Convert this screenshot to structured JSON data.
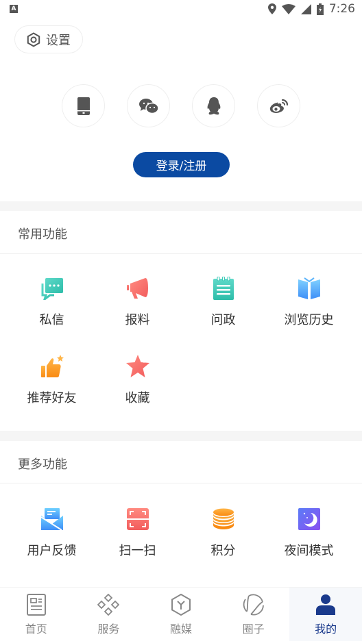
{
  "status_bar": {
    "time": "7:26",
    "left_icon": "A"
  },
  "settings": {
    "label": "设置",
    "icon": "hexagon-settings-icon"
  },
  "social_login": [
    {
      "name": "phone",
      "icon": "phone-icon"
    },
    {
      "name": "wechat",
      "icon": "wechat-icon"
    },
    {
      "name": "qq",
      "icon": "qq-icon"
    },
    {
      "name": "weibo",
      "icon": "weibo-icon"
    }
  ],
  "login_button": {
    "label": "登录/注册",
    "color": "#0b4aa2"
  },
  "common_features": {
    "title": "常用功能",
    "items": [
      {
        "label": "私信",
        "icon": "chat-bubble-icon"
      },
      {
        "label": "报料",
        "icon": "megaphone-icon"
      },
      {
        "label": "问政",
        "icon": "notepad-icon"
      },
      {
        "label": "浏览历史",
        "icon": "open-book-icon"
      },
      {
        "label": "推荐好友",
        "icon": "thumbs-up-icon"
      },
      {
        "label": "收藏",
        "icon": "star-icon"
      }
    ]
  },
  "more_features": {
    "title": "更多功能",
    "items": [
      {
        "label": "用户反馈",
        "icon": "envelope-icon"
      },
      {
        "label": "扫一扫",
        "icon": "scan-icon"
      },
      {
        "label": "积分",
        "icon": "coins-icon"
      },
      {
        "label": "夜间模式",
        "icon": "moon-icon"
      }
    ]
  },
  "tabbar": {
    "active_color": "#1a3a8c",
    "items": [
      {
        "label": "首页",
        "icon": "news-icon",
        "active": false
      },
      {
        "label": "服务",
        "icon": "diamonds-icon",
        "active": false
      },
      {
        "label": "融媒",
        "icon": "hexagon-y-icon",
        "active": false
      },
      {
        "label": "圈子",
        "icon": "circle-ring-icon",
        "active": false
      },
      {
        "label": "我的",
        "icon": "user-icon",
        "active": true
      }
    ]
  }
}
